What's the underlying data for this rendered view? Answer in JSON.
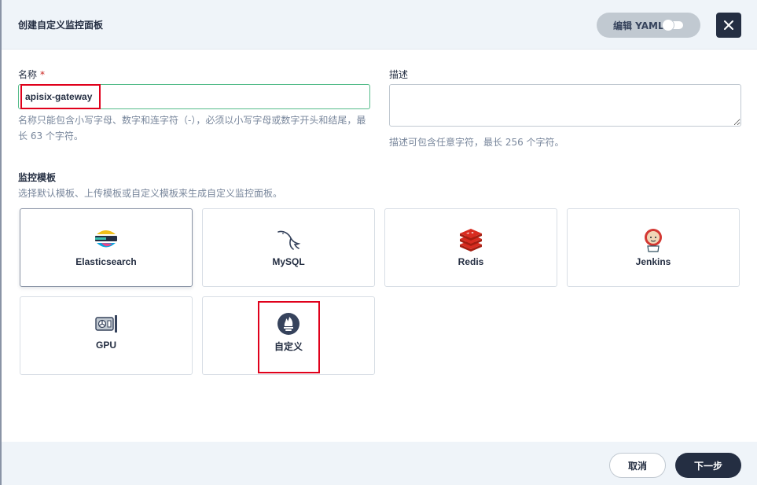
{
  "header": {
    "title": "创建自定义监控面板",
    "yaml_label": "编辑 YAML"
  },
  "form": {
    "name_label": "名称",
    "required_mark": "*",
    "name_value": "apisix-gateway",
    "name_hint": "名称只能包含小写字母、数字和连字符（-），必须以小写字母或数字开头和结尾，最长 63 个字符。",
    "desc_label": "描述",
    "desc_value": "",
    "desc_hint": "描述可包含任意字符，最长 256 个字符。"
  },
  "templates": {
    "title": "监控模板",
    "description": "选择默认模板、上传模板或自定义模板来生成自定义监控面板。",
    "items": [
      {
        "label": "Elasticsearch",
        "icon": "elasticsearch-icon",
        "selected": true
      },
      {
        "label": "MySQL",
        "icon": "mysql-icon",
        "selected": false
      },
      {
        "label": "Redis",
        "icon": "redis-icon",
        "selected": false
      },
      {
        "label": "Jenkins",
        "icon": "jenkins-icon",
        "selected": false
      },
      {
        "label": "GPU",
        "icon": "gpu-icon",
        "selected": false
      },
      {
        "label": "自定义",
        "icon": "prometheus-icon",
        "selected": false
      }
    ]
  },
  "footer": {
    "cancel_label": "取消",
    "next_label": "下一步"
  },
  "colors": {
    "accent": "#242e42",
    "success_border": "#55bc8a",
    "highlight": "#e0001b"
  }
}
